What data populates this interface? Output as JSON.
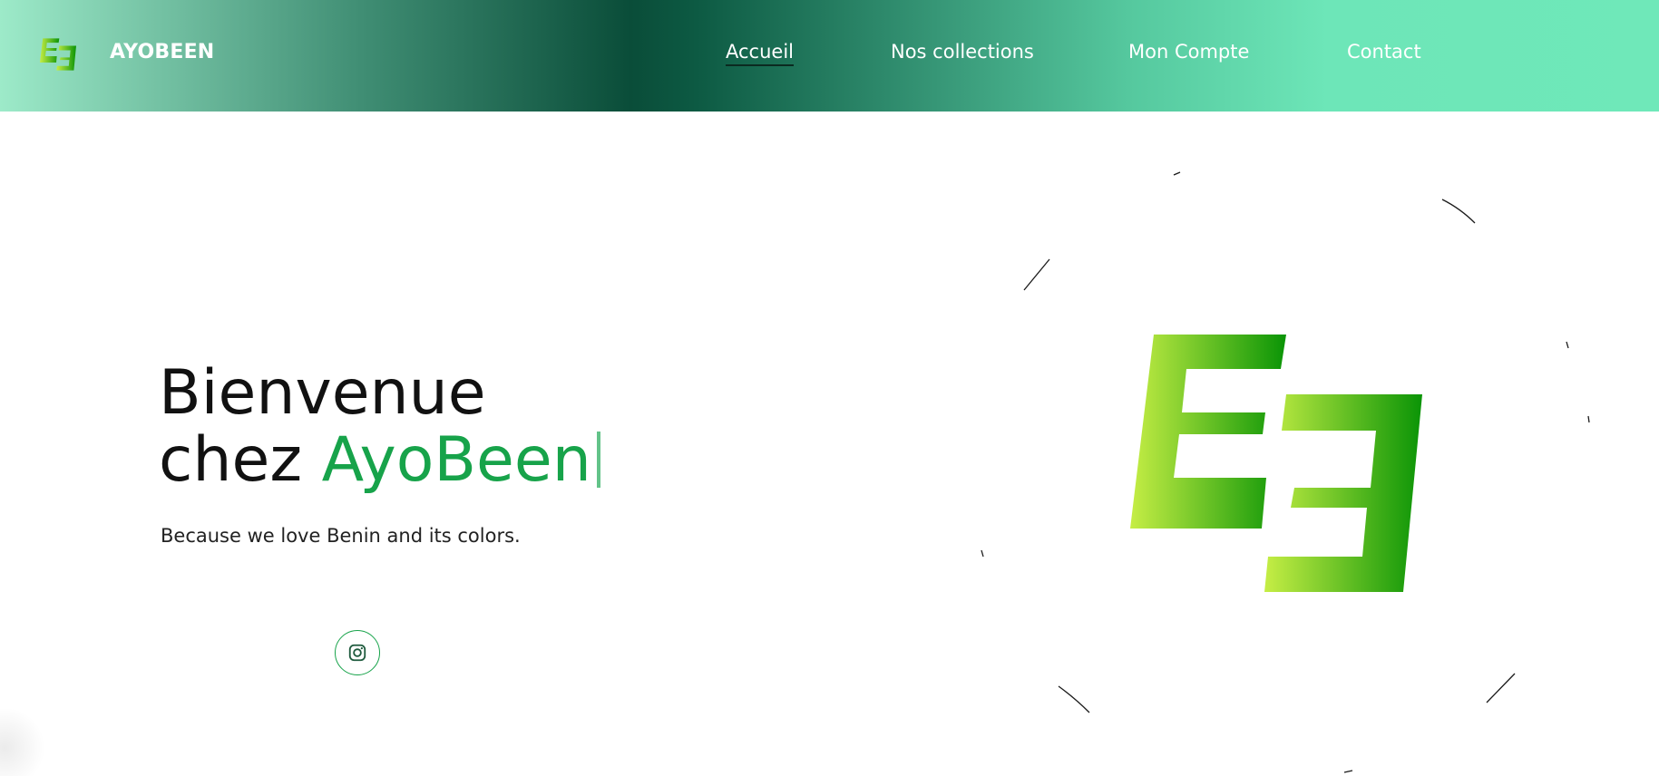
{
  "header": {
    "brand_name": "AYOBEEN",
    "logo_icon": "e3-logo-icon",
    "nav": [
      {
        "label": "Accueil",
        "active": true
      },
      {
        "label": "Nos collections",
        "active": false
      },
      {
        "label": "Mon Compte",
        "active": false
      },
      {
        "label": "Contact",
        "active": false
      }
    ]
  },
  "hero": {
    "title_line1": "Bienvenue",
    "title_prefix": "chez",
    "title_accent": "AyoBeen",
    "subtitle": "Because we love Benin and its colors.",
    "social_icon": "instagram-icon"
  },
  "colors": {
    "accent_green": "#17a34a",
    "header_dark": "#0a4d39",
    "header_light": "#6fe8b9",
    "logo_gradient_start": "#c6ee45",
    "logo_gradient_end": "#0a9406"
  }
}
